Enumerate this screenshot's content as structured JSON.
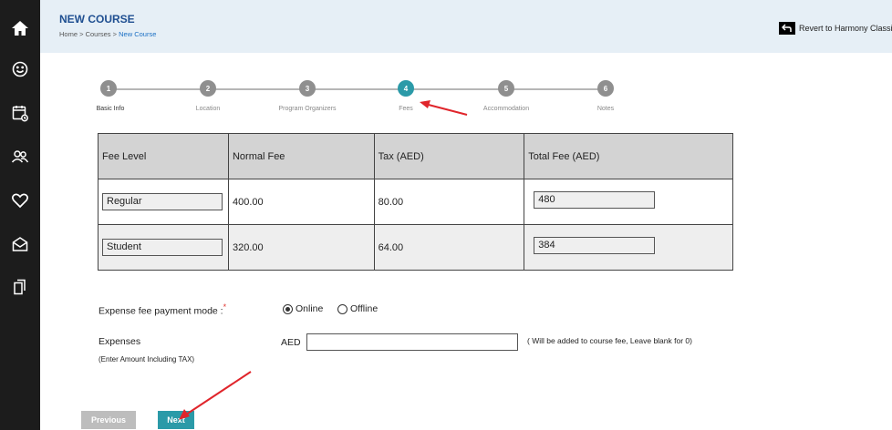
{
  "header": {
    "title": "NEW COURSE",
    "breadcrumb": {
      "home": "Home",
      "courses": "Courses",
      "current": "New Course",
      "separator": ">"
    },
    "revert_label": "Revert to Harmony Classi"
  },
  "sidebar": {
    "items": [
      {
        "icon": "home-icon"
      },
      {
        "icon": "smiley-icon"
      },
      {
        "icon": "calendar-icon"
      },
      {
        "icon": "users-icon"
      },
      {
        "icon": "heart-icon"
      },
      {
        "icon": "mail-icon"
      },
      {
        "icon": "copy-icon"
      }
    ]
  },
  "stepper": {
    "active_index": 3,
    "steps": [
      {
        "number": "1",
        "label": "Basic Info"
      },
      {
        "number": "2",
        "label": "Location"
      },
      {
        "number": "3",
        "label": "Program Organizers"
      },
      {
        "number": "4",
        "label": "Fees"
      },
      {
        "number": "5",
        "label": "Accommodation"
      },
      {
        "number": "6",
        "label": "Notes"
      }
    ]
  },
  "fee_table": {
    "headers": [
      "Fee Level",
      "Normal Fee",
      "Tax (AED)",
      "Total Fee (AED)"
    ],
    "rows": [
      {
        "level": "Regular",
        "normal_fee": "400.00",
        "tax": "80.00",
        "total": "480"
      },
      {
        "level": "Student",
        "normal_fee": "320.00",
        "tax": "64.00",
        "total": "384"
      }
    ]
  },
  "payment_mode": {
    "label": "Expense fee payment mode :",
    "required_mark": "*",
    "options": [
      "Online",
      "Offline"
    ],
    "selected": "Online"
  },
  "expenses": {
    "label": "Expenses",
    "hint": "(Enter Amount Including TAX)",
    "currency": "AED",
    "value": "",
    "note": "( Will be added to course fee, Leave blank for 0)"
  },
  "buttons": {
    "previous": "Previous",
    "next": "Next"
  },
  "colors": {
    "accent": "#2b9aa8",
    "title": "#1f4f91",
    "annotation": "#e0252b"
  }
}
